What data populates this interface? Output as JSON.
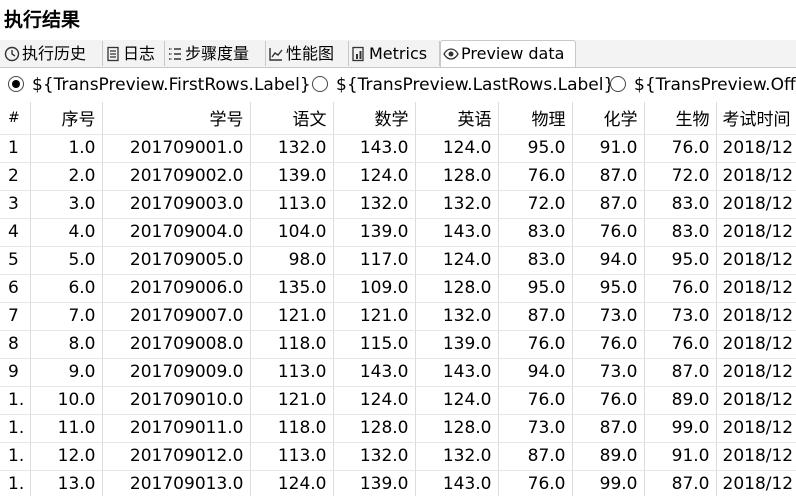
{
  "panel": {
    "title": "执行结果"
  },
  "tabs": [
    {
      "label": "执行历史",
      "icon": "clock-icon"
    },
    {
      "label": "日志",
      "icon": "log-icon"
    },
    {
      "label": "步骤度量",
      "icon": "step-metrics-icon"
    },
    {
      "label": "性能图",
      "icon": "chart-icon"
    },
    {
      "label": "Metrics",
      "icon": "metrics-icon"
    },
    {
      "label": "Preview data",
      "icon": "eye-icon",
      "active": true
    }
  ],
  "preview_options": [
    {
      "label": "${TransPreview.FirstRows.Label}",
      "checked": true
    },
    {
      "label": "${TransPreview.LastRows.Label}",
      "checked": false
    },
    {
      "label": "${TransPreview.Off",
      "checked": false
    }
  ],
  "table": {
    "columns": [
      "#",
      "序号",
      "学号",
      "语文",
      "数学",
      "英语",
      "物理",
      "化学",
      "生物",
      "考试时间"
    ],
    "rows": [
      [
        "1",
        "1.0",
        "201709001.0",
        "132.0",
        "143.0",
        "124.0",
        "95.0",
        "91.0",
        "76.0",
        "2018/12"
      ],
      [
        "2",
        "2.0",
        "201709002.0",
        "139.0",
        "124.0",
        "128.0",
        "76.0",
        "87.0",
        "72.0",
        "2018/12"
      ],
      [
        "3",
        "3.0",
        "201709003.0",
        "113.0",
        "132.0",
        "132.0",
        "72.0",
        "87.0",
        "83.0",
        "2018/12"
      ],
      [
        "4",
        "4.0",
        "201709004.0",
        "104.0",
        "139.0",
        "143.0",
        "83.0",
        "76.0",
        "83.0",
        "2018/12"
      ],
      [
        "5",
        "5.0",
        "201709005.0",
        "98.0",
        "117.0",
        "124.0",
        "83.0",
        "94.0",
        "95.0",
        "2018/12"
      ],
      [
        "6",
        "6.0",
        "201709006.0",
        "135.0",
        "109.0",
        "128.0",
        "95.0",
        "95.0",
        "76.0",
        "2018/12"
      ],
      [
        "7",
        "7.0",
        "201709007.0",
        "121.0",
        "121.0",
        "132.0",
        "87.0",
        "73.0",
        "73.0",
        "2018/12"
      ],
      [
        "8",
        "8.0",
        "201709008.0",
        "118.0",
        "115.0",
        "139.0",
        "76.0",
        "76.0",
        "76.0",
        "2018/12"
      ],
      [
        "9",
        "9.0",
        "201709009.0",
        "113.0",
        "143.0",
        "143.0",
        "94.0",
        "73.0",
        "87.0",
        "2018/12"
      ],
      [
        "1.",
        "10.0",
        "201709010.0",
        "121.0",
        "124.0",
        "124.0",
        "76.0",
        "76.0",
        "89.0",
        "2018/12"
      ],
      [
        "1.",
        "11.0",
        "201709011.0",
        "118.0",
        "128.0",
        "128.0",
        "73.0",
        "87.0",
        "99.0",
        "2018/12"
      ],
      [
        "1.",
        "12.0",
        "201709012.0",
        "113.0",
        "132.0",
        "132.0",
        "87.0",
        "89.0",
        "91.0",
        "2018/12"
      ],
      [
        "1.",
        "13.0",
        "201709013.0",
        "124.0",
        "139.0",
        "143.0",
        "76.0",
        "99.0",
        "87.0",
        "2018/12"
      ]
    ]
  }
}
